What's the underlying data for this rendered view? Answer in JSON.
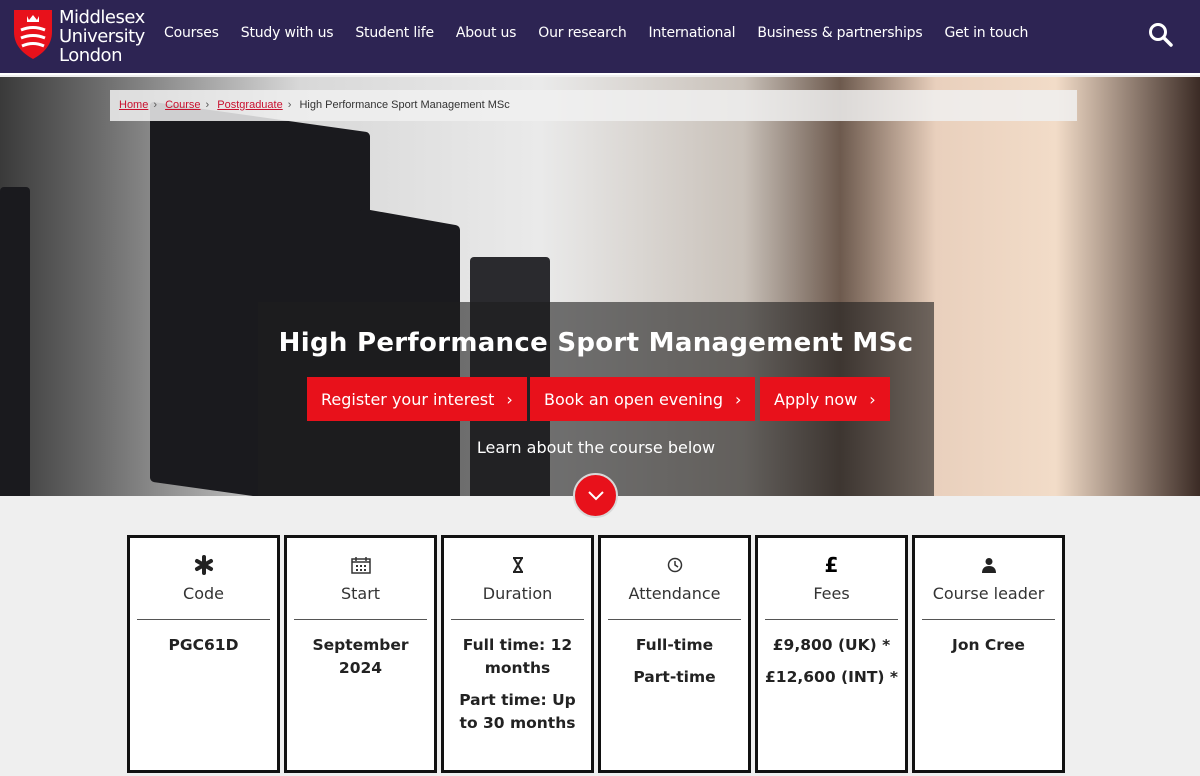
{
  "header": {
    "logo": {
      "line1": "Middlesex",
      "line2": "University",
      "line3": "London"
    },
    "nav": [
      "Courses",
      "Study with us",
      "Student life",
      "About us",
      "Our research",
      "International",
      "Business & partnerships",
      "Get in touch"
    ]
  },
  "breadcrumb": {
    "items": [
      "Home",
      "Course",
      "Postgraduate"
    ],
    "current": "High Performance Sport Management MSc"
  },
  "hero": {
    "title": "High Performance Sport Management MSc",
    "buttons": [
      "Register your interest",
      "Book an open evening",
      "Apply now"
    ],
    "learn": "Learn about the course below"
  },
  "cards": [
    {
      "icon": "asterisk-icon",
      "label": "Code",
      "values": [
        "PGC61D"
      ]
    },
    {
      "icon": "calendar-icon",
      "label": "Start",
      "values": [
        "September 2024"
      ]
    },
    {
      "icon": "hourglass-icon",
      "label": "Duration",
      "values": [
        "Full time: 12 months",
        "Part time: Up to 30 months"
      ]
    },
    {
      "icon": "clock-icon",
      "label": "Attendance",
      "values": [
        "Full-time",
        "Part-time"
      ]
    },
    {
      "icon": "pound-icon",
      "label": "Fees",
      "values": [
        "£9,800 (UK) *",
        "£12,600 (INT) *"
      ]
    },
    {
      "icon": "person-icon",
      "label": "Course leader",
      "values": [
        "Jon Cree"
      ]
    }
  ],
  "colors": {
    "nav": "#2d2453",
    "accent": "#e8111b"
  }
}
